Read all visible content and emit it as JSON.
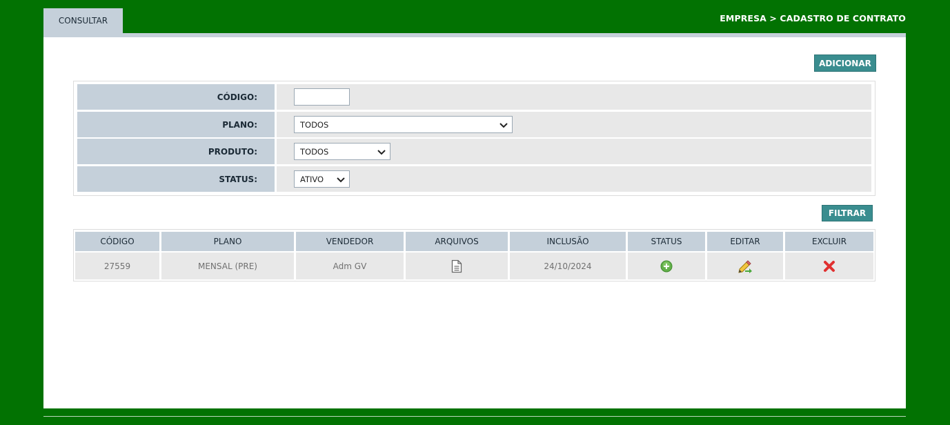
{
  "tabs": [
    {
      "label": "CONSULTAR"
    }
  ],
  "breadcrumb": "EMPRESA > CADASTRO DE CONTRATO",
  "buttons": {
    "add": "ADICIONAR",
    "filter": "FILTRAR"
  },
  "filters": {
    "codigo": {
      "label": "CÓDIGO:",
      "value": ""
    },
    "plano": {
      "label": "PLANO:",
      "selected": "TODOS"
    },
    "produto": {
      "label": "PRODUTO:",
      "selected": "TODOS"
    },
    "status": {
      "label": "STATUS:",
      "selected": "ATIVO"
    }
  },
  "table": {
    "headers": [
      "CÓDIGO",
      "PLANO",
      "VENDEDOR",
      "ARQUIVOS",
      "INCLUSÃO",
      "STATUS",
      "EDITAR",
      "EXCLUIR"
    ],
    "rows": [
      {
        "codigo": "27559",
        "plano": "MENSAL (PRE)",
        "vendedor": "Adm GV",
        "arquivos": "file-icon",
        "inclusao": "24/10/2024",
        "status": "active-icon",
        "editar": "edit-icon",
        "excluir": "delete-icon"
      }
    ]
  },
  "colors": {
    "background": "#027202",
    "header": "#c5d0da",
    "button": "#3a8d8f",
    "cell": "#e8e8e8"
  }
}
